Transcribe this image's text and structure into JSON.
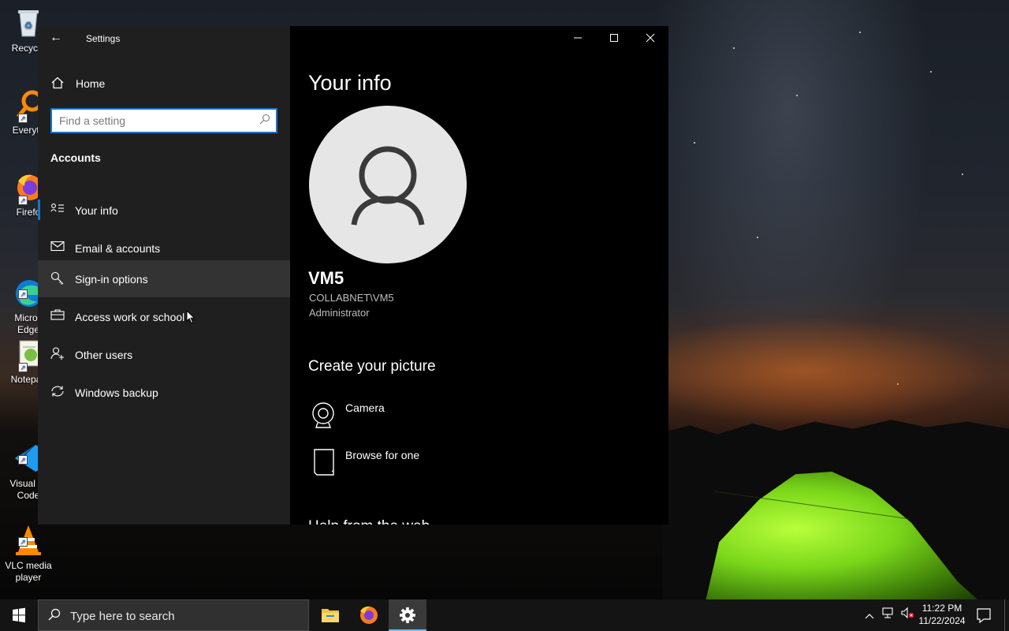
{
  "desktop": {
    "icons": [
      {
        "label": "Recycle",
        "name": "recycle-bin"
      },
      {
        "label": "Everyth",
        "name": "everything"
      },
      {
        "label": "Firefo",
        "name": "firefox"
      },
      {
        "label": "Micros\nEdge",
        "name": "microsoft-edge"
      },
      {
        "label": "Notepac",
        "name": "notepad-plus-plus"
      },
      {
        "label": "Visual St\nCode",
        "name": "visual-studio-code"
      },
      {
        "label": "VLC media\nplayer",
        "name": "vlc-media-player"
      }
    ]
  },
  "settings": {
    "title": "Settings",
    "back_icon": "back-arrow-icon",
    "home_label": "Home",
    "search_placeholder": "Find a setting",
    "section_header": "Accounts",
    "nav_items": [
      {
        "label": "Your info",
        "icon": "contact-card-icon",
        "selected": true
      },
      {
        "label": "Email & accounts",
        "icon": "mail-icon"
      },
      {
        "label": "Sign-in options",
        "icon": "key-icon",
        "hovered": true
      },
      {
        "label": "Access work or school",
        "icon": "briefcase-icon"
      },
      {
        "label": "Other users",
        "icon": "add-user-icon"
      },
      {
        "label": "Windows backup",
        "icon": "sync-icon"
      }
    ],
    "window_controls": [
      "minimize",
      "maximize",
      "close"
    ],
    "content": {
      "page_title": "Your info",
      "user_name": "VM5",
      "account": "COLLABNET\\VM5",
      "role": "Administrator",
      "create_picture_header": "Create your picture",
      "picture_options": [
        {
          "label": "Camera",
          "icon": "webcam-icon"
        },
        {
          "label": "Browse for one",
          "icon": "document-icon"
        }
      ],
      "cut_off_header": "Help from the web"
    }
  },
  "taskbar": {
    "search_text": "Type here to search",
    "apps": [
      {
        "name": "file-explorer",
        "active": false
      },
      {
        "name": "firefox",
        "active": false
      },
      {
        "name": "settings",
        "active": true
      }
    ],
    "clock_time": "11:22 PM",
    "clock_date": "11/22/2024"
  },
  "colors": {
    "accent": "#1a73c8",
    "nav_background": "#1f1f1f",
    "content_background": "#000000",
    "hover_background": "#333333"
  }
}
